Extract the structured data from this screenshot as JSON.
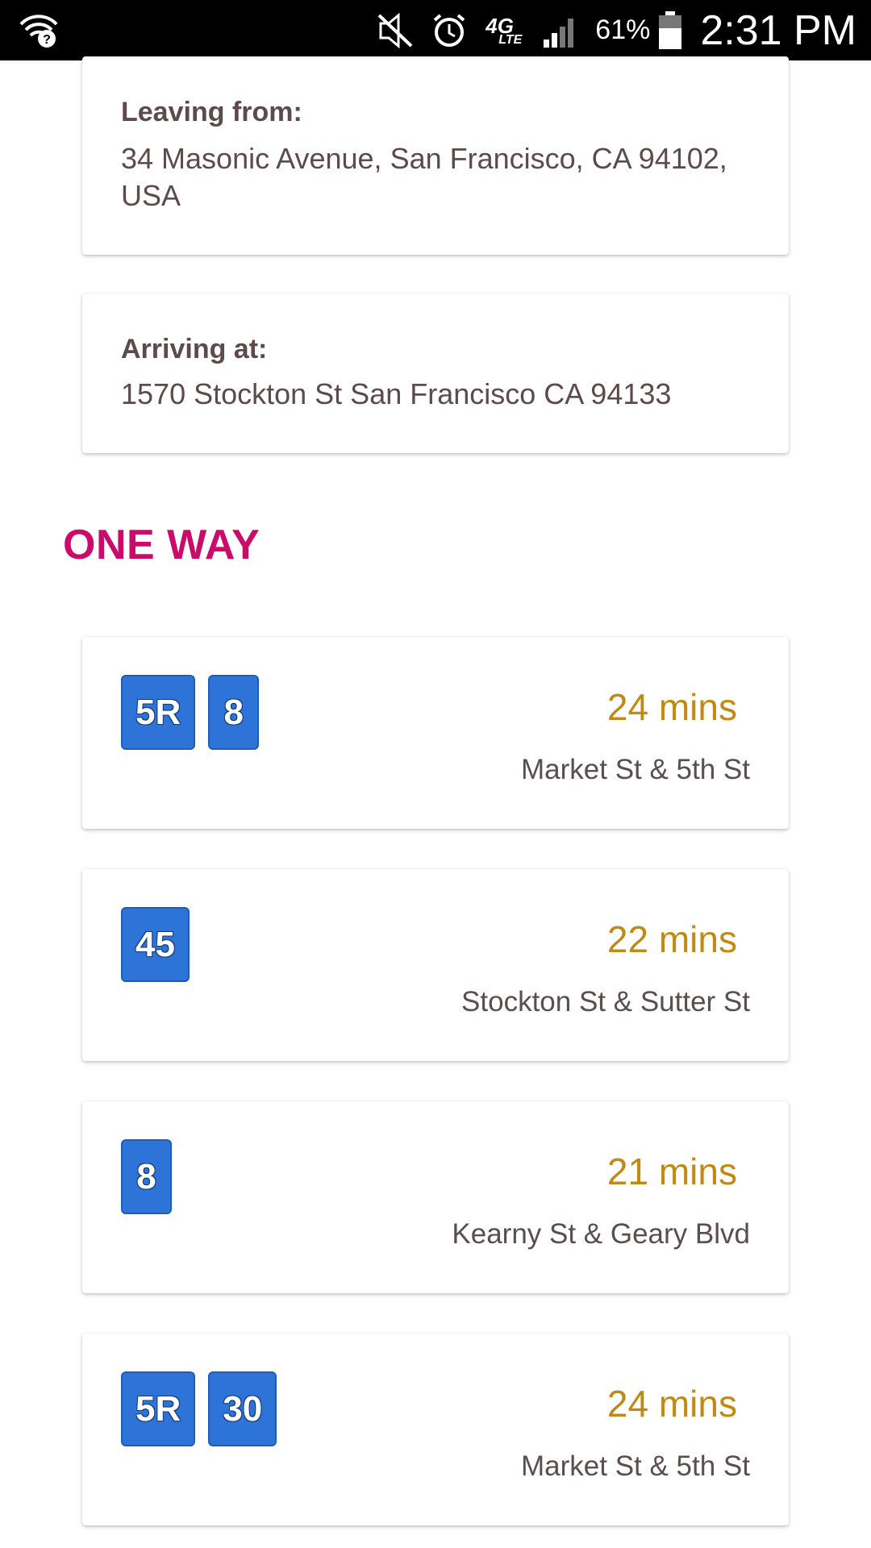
{
  "status_bar": {
    "battery_percent": "61%",
    "time": "2:31 PM",
    "network_label": "4G",
    "network_sub": "LTE",
    "icons": [
      "wifi-question-icon",
      "mute-vibrate-icon",
      "alarm-icon",
      "lte-icon",
      "signal-icon",
      "battery-icon"
    ]
  },
  "origin": {
    "label": "Leaving from:",
    "address": "34 Masonic Avenue, San Francisco, CA 94102, USA"
  },
  "destination": {
    "label": "Arriving at:",
    "address": "1570 Stockton St San Francisco CA 94133"
  },
  "section": {
    "title": "ONE WAY"
  },
  "routes": [
    {
      "lines": [
        "5R",
        "8"
      ],
      "duration": "24 mins",
      "stop": "Market St & 5th St"
    },
    {
      "lines": [
        "45"
      ],
      "duration": "22 mins",
      "stop": "Stockton St & Sutter St"
    },
    {
      "lines": [
        "8"
      ],
      "duration": "21 mins",
      "stop": "Kearny St & Geary Blvd"
    },
    {
      "lines": [
        "5R",
        "30"
      ],
      "duration": "24 mins",
      "stop": "Market St & 5th St"
    }
  ],
  "colors": {
    "accent": "#cc0a6a",
    "badge": "#2e74d8",
    "duration": "#c08a14",
    "text": "#5d4a4a"
  }
}
